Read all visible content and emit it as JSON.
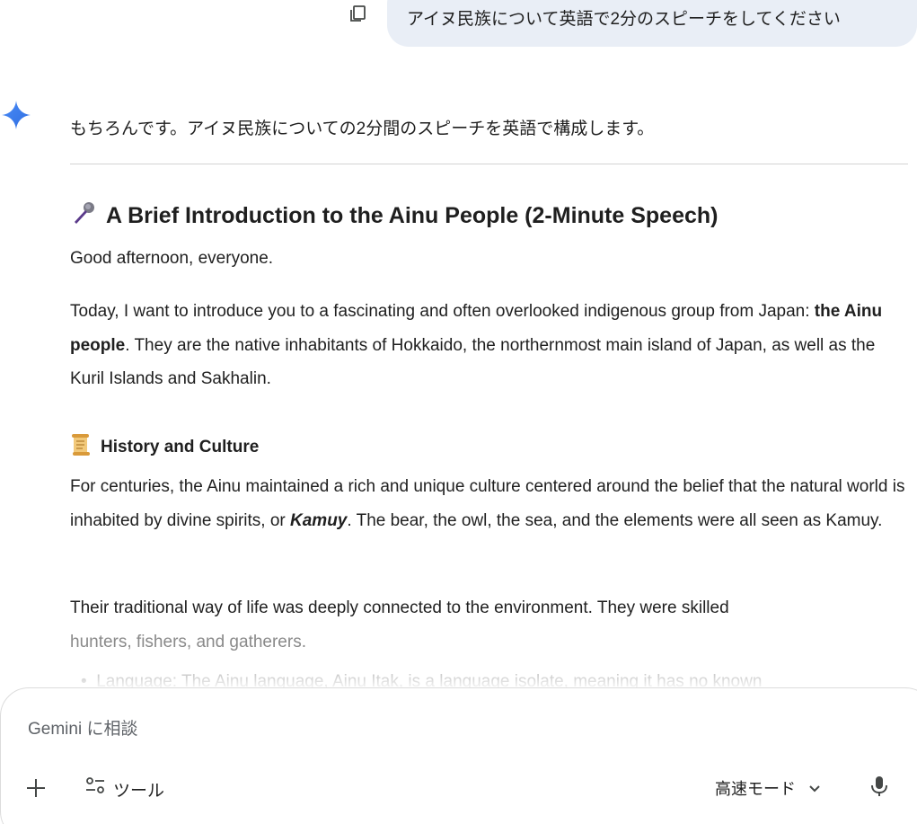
{
  "user_message": {
    "text": "アイヌ民族について英語で2分のスピーチをしてください",
    "copy_icon": "copy-icon"
  },
  "response": {
    "intro": "もちろんです。アイヌ民族についての2分間のスピーチを英語で構成します。",
    "title_icon": "microphone-emoji",
    "title": "A Brief Introduction to the Ainu People (2-Minute Speech)",
    "greeting": "Good afternoon, everyone.",
    "para1_a": "Today, I want to introduce you to a fascinating and often overlooked indigenous group from Japan: ",
    "para1_bold": "the Ainu people",
    "para1_b": ". They are the native inhabitants of Hokkaido, the northernmost main island of Japan, as well as the Kuril Islands and Sakhalin.",
    "section_icon": "scroll-emoji",
    "section_title": "History and Culture",
    "para2_a": "For centuries, the Ainu maintained a rich and unique culture centered around the belief that the natural world is inhabited by divine spirits, or ",
    "para2_em": "Kamuy",
    "para2_b": ". The bear, the owl, the sea, and the elements were all seen as Kamuy.",
    "para3_a": "Their traditional way of life was deeply connected to the environment. They were skilled ",
    "para3_b": "hunters, fishers, and gatherers.",
    "bullet_faded": "Language: The Ainu language, Ainu Itak, is a language isolate, meaning it has no known"
  },
  "input": {
    "placeholder": "Gemini に相談",
    "tools_label": "ツール",
    "mode_label": "高速モード",
    "accent": "#e9eef6"
  }
}
